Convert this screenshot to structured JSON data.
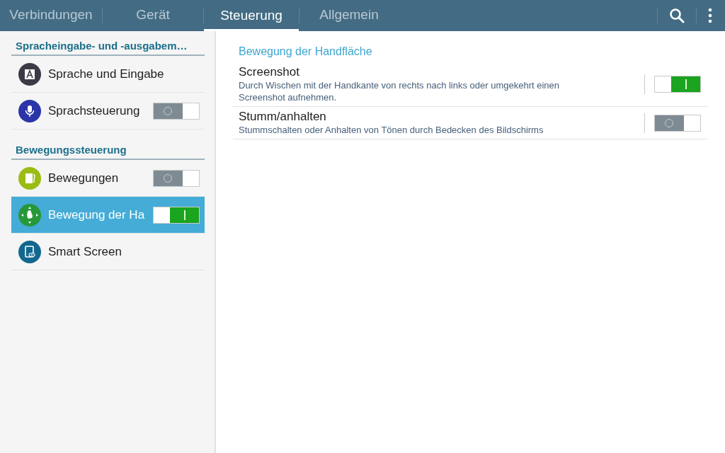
{
  "tabs": [
    {
      "label": "Verbindungen",
      "selected": false
    },
    {
      "label": "Gerät",
      "selected": false
    },
    {
      "label": "Steuerung",
      "selected": true
    },
    {
      "label": "Allgemein",
      "selected": false
    }
  ],
  "sidebar": {
    "sections": [
      {
        "heading": "Spracheingabe- und -ausgabem…",
        "items": [
          {
            "label": "Sprache und Eingabe",
            "kind": "letter",
            "color": "#3d3a45",
            "selected": false
          },
          {
            "label": "Sprachsteuerung",
            "kind": "mic",
            "color": "#2b35a8",
            "selected": false,
            "on": false
          }
        ]
      },
      {
        "heading": "Bewegungssteuerung",
        "items": [
          {
            "label": "Bewegungen",
            "kind": "tablet",
            "color": "#9bbc14",
            "selected": false,
            "on": false
          },
          {
            "label": "Bewegung der Ha",
            "kind": "hand",
            "color": "#27983a",
            "selected": true,
            "on": true
          },
          {
            "label": "Smart Screen",
            "kind": "eye",
            "color": "#12678f",
            "selected": false
          }
        ]
      }
    ]
  },
  "detail": {
    "title": "Bewegung der Handfläche",
    "settings": [
      {
        "title": "Screenshot",
        "description": "Durch Wischen mit der Handkante von rechts nach links oder umgekehrt einen Screenshot aufnehmen.",
        "on": true
      },
      {
        "title": "Stumm/anhalten",
        "description": "Stummschalten oder Anhalten von Tönen durch Bedecken des Bildschirms",
        "on": false
      }
    ]
  }
}
